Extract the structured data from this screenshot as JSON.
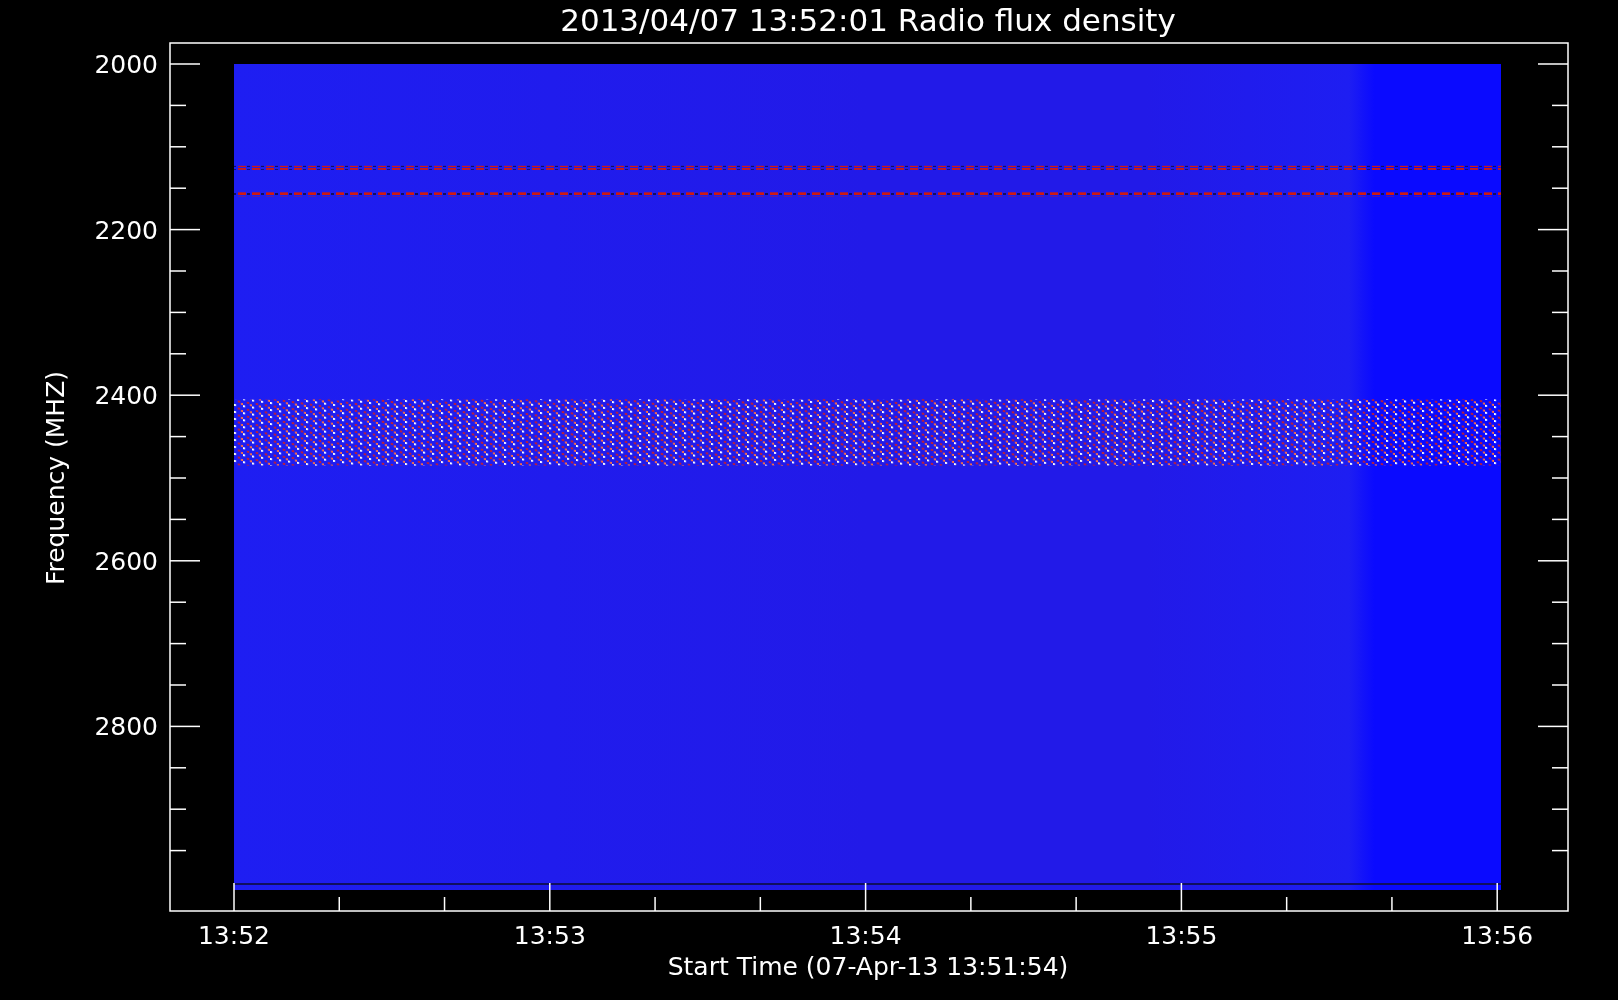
{
  "title": "2013/04/07 13:52:01 Radio flux density",
  "y_axis": {
    "label": "Frequency (MHZ)",
    "ticks": [
      "2000",
      "2200",
      "2400",
      "2600",
      "2800"
    ]
  },
  "x_axis": {
    "label": "Start Time (07-Apr-13 13:51:54)",
    "ticks": [
      "13:52",
      "13:53",
      "13:54",
      "13:55",
      "13:56"
    ]
  }
}
